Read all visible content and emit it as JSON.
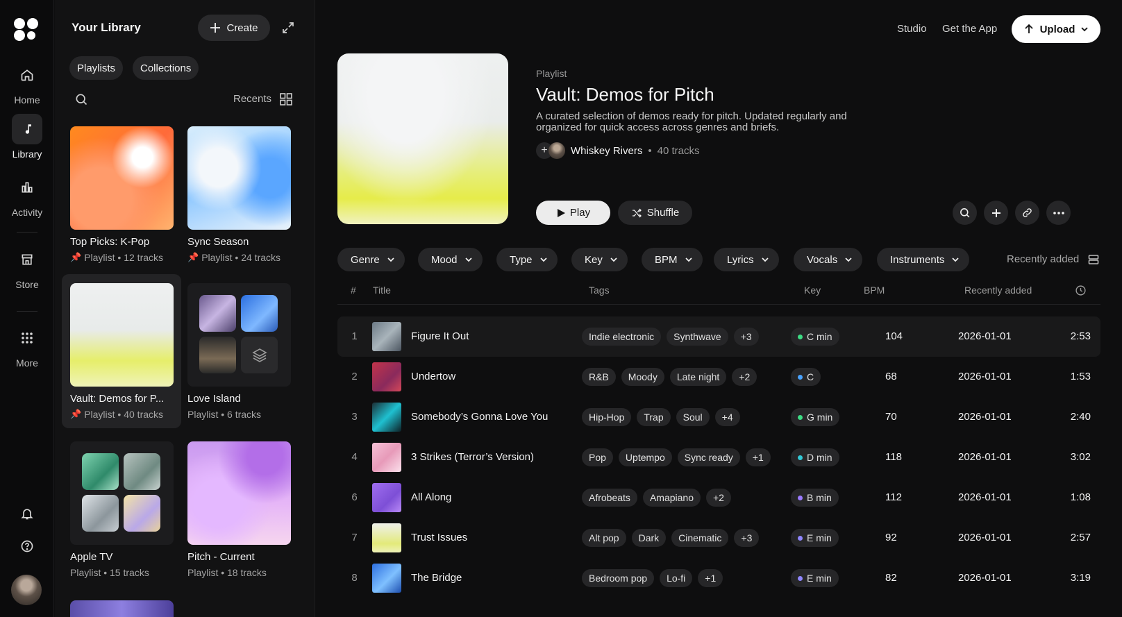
{
  "rail": {
    "items": [
      {
        "label": "Home",
        "icon": "home-icon"
      },
      {
        "label": "Library",
        "icon": "music-note-icon"
      },
      {
        "label": "Activity",
        "icon": "bar-chart-icon"
      },
      {
        "label": "Store",
        "icon": "store-icon"
      },
      {
        "label": "More",
        "icon": "dots-grid-icon"
      }
    ]
  },
  "library": {
    "title": "Your Library",
    "create_label": "Create",
    "filters": [
      "Playlists",
      "Collections"
    ],
    "sort_label": "Recents",
    "cards": [
      {
        "name": "Top Picks: K-Pop",
        "meta": "Playlist • 12 tracks",
        "pinned": true
      },
      {
        "name": "Sync Season",
        "meta": "Playlist • 24 tracks",
        "pinned": true
      },
      {
        "name": "Vault: Demos for P...",
        "meta": "Playlist • 40 tracks",
        "pinned": true
      },
      {
        "name": "Love Island",
        "meta": "Playlist • 6 tracks",
        "pinned": false
      },
      {
        "name": "Apple TV",
        "meta": "Playlist • 15 tracks",
        "pinned": false
      },
      {
        "name": "Pitch - Current",
        "meta": "Playlist • 18 tracks",
        "pinned": false
      }
    ]
  },
  "header": {
    "studio_label": "Studio",
    "get_app_label": "Get the App",
    "upload_label": "Upload"
  },
  "playlist": {
    "kind": "Playlist",
    "title": "Vault: Demos for Pitch",
    "description": "A curated selection of demos ready for pitch. Updated regularly and organized for quick access across genres and briefs.",
    "owner": "Whiskey Rivers",
    "track_count": "40 tracks",
    "play_label": "Play",
    "shuffle_label": "Shuffle"
  },
  "filters": [
    "Genre",
    "Mood",
    "Type",
    "Key",
    "BPM",
    "Lyrics",
    "Vocals",
    "Instruments"
  ],
  "sort": {
    "label": "Recently added"
  },
  "table": {
    "headers": {
      "num": "#",
      "title": "Title",
      "tags": "Tags",
      "key": "Key",
      "bpm": "BPM",
      "added": "Recently added"
    },
    "rows": [
      {
        "num": "1",
        "title": "Figure It Out",
        "tags": [
          "Indie electronic",
          "Synthwave",
          "+3"
        ],
        "key": "C min",
        "key_color": "#3ddc84",
        "bpm": "104",
        "added": "2026-01-01",
        "duration": "2:53"
      },
      {
        "num": "2",
        "title": "Undertow",
        "tags": [
          "R&B",
          "Moody",
          "Late night",
          "+2"
        ],
        "key": "C",
        "key_color": "#4aa3ff",
        "bpm": "68",
        "added": "2026-01-01",
        "duration": "1:53"
      },
      {
        "num": "3",
        "title": "Somebody’s Gonna Love You",
        "tags": [
          "Hip-Hop",
          "Trap",
          "Soul",
          "+4"
        ],
        "key": "G min",
        "key_color": "#3ddc84",
        "bpm": "70",
        "added": "2026-01-01",
        "duration": "2:40"
      },
      {
        "num": "4",
        "title": "3 Strikes (Terror’s Version)",
        "tags": [
          "Pop",
          "Uptempo",
          "Sync ready",
          "+1"
        ],
        "key": "D min",
        "key_color": "#33c9d6",
        "bpm": "118",
        "added": "2026-01-01",
        "duration": "3:02"
      },
      {
        "num": "6",
        "title": "All Along",
        "tags": [
          "Afrobeats",
          "Amapiano",
          "+2"
        ],
        "key": "B min",
        "key_color": "#9b7bff",
        "bpm": "112",
        "added": "2026-01-01",
        "duration": "1:08"
      },
      {
        "num": "7",
        "title": "Trust Issues",
        "tags": [
          "Alt pop",
          "Dark",
          "Cinematic",
          "+3"
        ],
        "key": "E min",
        "key_color": "#8f86ff",
        "bpm": "92",
        "added": "2026-01-01",
        "duration": "2:57"
      },
      {
        "num": "8",
        "title": "The Bridge",
        "tags": [
          "Bedroom pop",
          "Lo-fi",
          "+1"
        ],
        "key": "E min",
        "key_color": "#8f86ff",
        "bpm": "82",
        "added": "2026-01-01",
        "duration": "3:19"
      }
    ]
  },
  "colors": {
    "accent_green": "#3ddc84",
    "background": "#0e0e0f",
    "panel": "#121213"
  }
}
